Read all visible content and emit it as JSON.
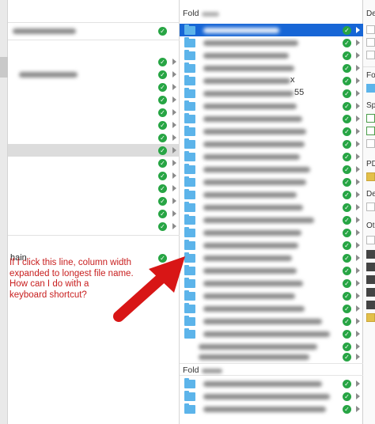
{
  "column1": {
    "chain_label": "hain",
    "note_lines": [
      "If I click this line, column width",
      "expanded to longest file name.",
      "How can I do with a",
      "keyboard shortcut?"
    ]
  },
  "column2": {
    "header_title": "Fold",
    "rows": [
      {
        "suffix": ""
      },
      {
        "suffix": ""
      },
      {
        "suffix": ""
      },
      {
        "suffix": ""
      },
      {
        "suffix": ""
      },
      {
        "suffix": "x"
      },
      {
        "suffix": "55"
      }
    ],
    "bottom_header_title": "Fold"
  },
  "column3": {
    "header_title": "De",
    "labels": [
      "Fo",
      "Sp",
      "PD",
      "De",
      "Ot"
    ]
  },
  "icons": {
    "check": "check-icon",
    "chevron": "chevron-right-icon",
    "folder": "folder-icon"
  },
  "colors": {
    "selection": "#1766d6",
    "check": "#27a544",
    "folder": "#5cb4ea",
    "annotation": "#c81e1e",
    "arrow": "#d81616"
  }
}
